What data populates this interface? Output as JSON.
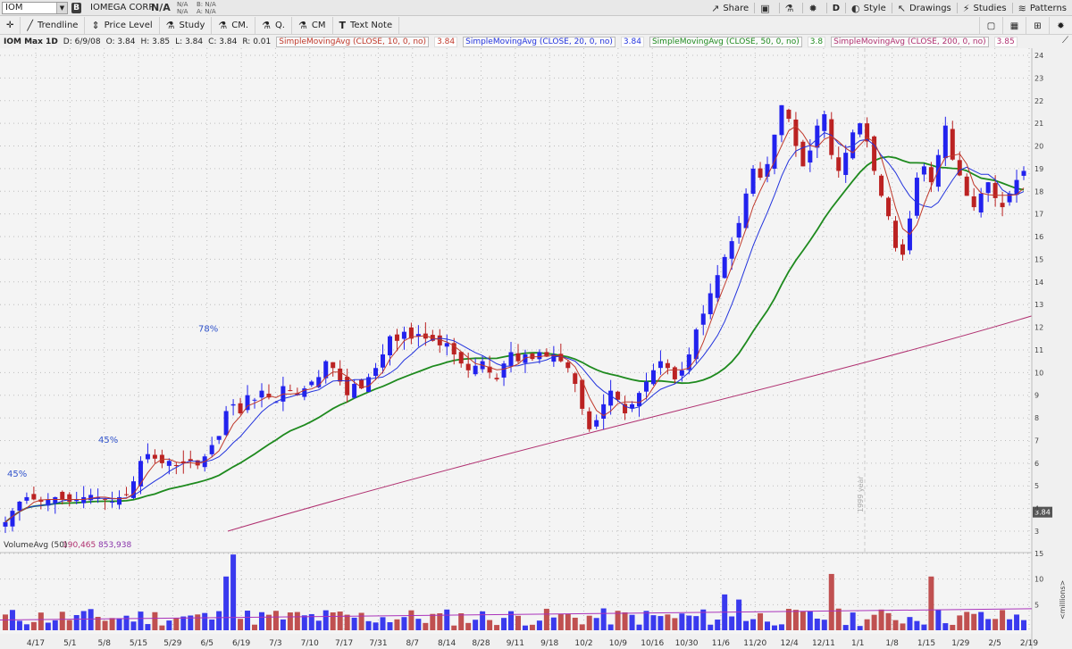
{
  "header": {
    "symbol": "IOM",
    "company": "IOMEGA CORP",
    "last": "N/A",
    "na_col1": [
      "N/A",
      "N/A"
    ],
    "na_col2": [
      "B: N/A",
      "A: N/A"
    ],
    "buttons": [
      "Share",
      "D",
      "Style",
      "Drawings",
      "Studies",
      "Patterns"
    ]
  },
  "drawing_tools": [
    "Trendline",
    "Price Level",
    "Study",
    "CM.",
    "Q.",
    "CM",
    "Text Note"
  ],
  "info": {
    "symbol_period": "IOM Max 1D",
    "date": "D: 6/9/08",
    "open": "O: 3.84",
    "high": "H: 3.85",
    "low": "L: 3.84",
    "close": "C: 3.84",
    "range": "R: 0.01",
    "studies": [
      {
        "label": "SimpleMovingAvg (CLOSE, 10, 0, no)",
        "value": "3.84",
        "color": "#c0392b"
      },
      {
        "label": "SimpleMovingAvg (CLOSE, 20, 0, no)",
        "value": "3.84",
        "color": "#2233dd"
      },
      {
        "label": "SimpleMovingAvg (CLOSE, 50, 0, no)",
        "value": "3.8",
        "color": "#1e8a1e"
      },
      {
        "label": "SimpleMovingAvg (CLOSE, 200, 0, no)",
        "value": "3.85",
        "color": "#b03070"
      }
    ]
  },
  "chart_data": {
    "type": "candlestick",
    "price_axis": {
      "min": 3,
      "max": 24,
      "ticks": [
        3,
        4,
        5,
        6,
        7,
        8,
        9,
        10,
        11,
        12,
        13,
        14,
        15,
        16,
        17,
        18,
        19,
        20,
        21,
        22,
        23,
        24
      ]
    },
    "last_price_label": "3.84",
    "date_labels": [
      "4/17",
      "5/1",
      "5/8",
      "5/15",
      "5/29",
      "6/5",
      "6/19",
      "7/3",
      "7/10",
      "7/17",
      "7/31",
      "8/7",
      "8/14",
      "8/28",
      "9/11",
      "9/18",
      "10/2",
      "10/9",
      "10/16",
      "10/30",
      "11/6",
      "11/20",
      "12/4",
      "12/11",
      "1/1",
      "1/8",
      "1/15",
      "1/29",
      "2/5",
      "2/19"
    ],
    "year_marker": "1999 year",
    "annotations": [
      "45%",
      "45%",
      "78%"
    ],
    "closes": [
      3.4,
      3.9,
      4.3,
      4.5,
      4.4,
      4.3,
      4.4,
      4.5,
      4.4,
      4.3,
      4.4,
      4.5,
      4.6,
      4.5,
      4.4,
      4.3,
      4.5,
      4.6,
      5.2,
      6.1,
      6.4,
      6.2,
      6.0,
      6.1,
      5.9,
      6.0,
      6.1,
      5.9,
      6.3,
      6.8,
      7.2,
      8.3,
      8.6,
      8.2,
      9.0,
      8.8,
      9.2,
      8.9,
      8.7,
      9.4,
      9.2,
      9.0,
      9.3,
      9.6,
      9.8,
      10.5,
      10.2,
      9.6,
      9.0,
      9.5,
      9.3,
      9.8,
      10.2,
      10.8,
      11.6,
      11.4,
      11.8,
      11.5,
      11.7,
      11.5,
      11.4,
      11.2,
      11.3,
      10.8,
      10.4,
      10.1,
      10.3,
      10.5,
      10.0,
      9.7,
      10.4,
      10.9,
      10.5,
      10.8,
      10.6,
      10.9,
      10.7,
      10.8,
      10.5,
      10.2,
      9.5,
      8.4,
      7.5,
      7.9,
      8.6,
      9.2,
      8.8,
      8.2,
      8.6,
      9.1,
      9.6,
      10.1,
      10.5,
      10.2,
      9.7,
      10.1,
      10.8,
      11.9,
      12.6,
      13.5,
      14.3,
      15.1,
      15.8,
      16.6,
      17.9,
      19.0,
      18.6,
      19.2,
      20.5,
      21.8,
      21.2,
      20.0,
      19.1,
      19.8,
      20.9,
      21.4,
      19.6,
      18.9,
      19.7,
      20.6,
      21.0,
      20.2,
      18.9,
      17.8,
      16.9,
      15.5,
      15.2,
      16.8,
      18.6,
      19.1,
      18.4,
      19.6,
      20.9,
      19.4,
      18.7,
      17.8,
      17.3,
      17.9,
      18.4,
      17.7,
      17.3,
      17.9,
      18.5,
      18.9
    ],
    "sma10": [],
    "sma20": [],
    "sma50": [],
    "sma200": [],
    "volume": {
      "label": "VolumeAvg (50)",
      "values_label": [
        "190,465",
        "853,938"
      ],
      "axis_ticks": [
        5,
        10,
        15
      ],
      "unit": "<millions>"
    }
  }
}
